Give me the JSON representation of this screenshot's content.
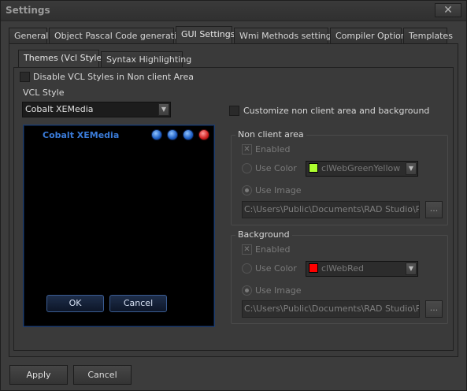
{
  "window": {
    "title": "Settings",
    "close_glyph": "✕"
  },
  "tabs": [
    {
      "label": "General"
    },
    {
      "label": "Object Pascal Code generation"
    },
    {
      "label": "GUI Settings"
    },
    {
      "label": "Wmi Methods settings"
    },
    {
      "label": "Compiler Options"
    },
    {
      "label": "Templates"
    }
  ],
  "active_tab": "GUI Settings",
  "subtabs": [
    {
      "label": "Themes (Vcl Styles)"
    },
    {
      "label": "Syntax Highlighting"
    }
  ],
  "themes": {
    "disable_vcl_non_client_label": "Disable VCL Styles in Non client Area",
    "vcl_style_label": "VCL Style",
    "vcl_style_value": "Cobalt XEMedia",
    "customize_label": "Customize non client area and background",
    "preview": {
      "title": "Cobalt XEMedia",
      "ok_label": "OK",
      "cancel_label": "Cancel"
    },
    "non_client_area": {
      "title": "Non client area",
      "enabled_label": "Enabled",
      "use_color_label": "Use Color",
      "color_value": "clWebGreenYellow",
      "color_hex": "#ADFF2F",
      "use_image_label": "Use Image",
      "image_path": "C:\\Users\\Public\\Documents\\RAD Studio\\Projec",
      "browse_label": "..."
    },
    "background": {
      "title": "Background",
      "enabled_label": "Enabled",
      "use_color_label": "Use Color",
      "color_value": "clWebRed",
      "color_hex": "#FF0000",
      "use_image_label": "Use Image",
      "image_path": "C:\\Users\\Public\\Documents\\RAD Studio\\Projec",
      "browse_label": "..."
    }
  },
  "footer": {
    "apply_label": "Apply",
    "cancel_label": "Cancel"
  }
}
